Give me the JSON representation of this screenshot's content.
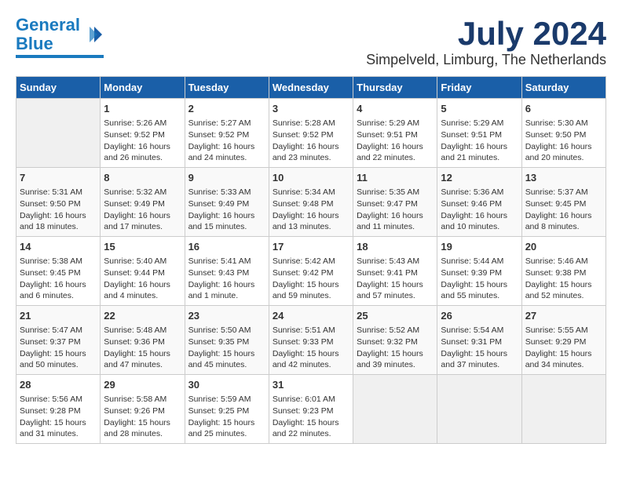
{
  "header": {
    "logo_line1": "General",
    "logo_line2": "Blue",
    "month": "July 2024",
    "location": "Simpelveld, Limburg, The Netherlands"
  },
  "days_of_week": [
    "Sunday",
    "Monday",
    "Tuesday",
    "Wednesday",
    "Thursday",
    "Friday",
    "Saturday"
  ],
  "weeks": [
    [
      {
        "day": "",
        "content": ""
      },
      {
        "day": "1",
        "content": "Sunrise: 5:26 AM\nSunset: 9:52 PM\nDaylight: 16 hours\nand 26 minutes."
      },
      {
        "day": "2",
        "content": "Sunrise: 5:27 AM\nSunset: 9:52 PM\nDaylight: 16 hours\nand 24 minutes."
      },
      {
        "day": "3",
        "content": "Sunrise: 5:28 AM\nSunset: 9:52 PM\nDaylight: 16 hours\nand 23 minutes."
      },
      {
        "day": "4",
        "content": "Sunrise: 5:29 AM\nSunset: 9:51 PM\nDaylight: 16 hours\nand 22 minutes."
      },
      {
        "day": "5",
        "content": "Sunrise: 5:29 AM\nSunset: 9:51 PM\nDaylight: 16 hours\nand 21 minutes."
      },
      {
        "day": "6",
        "content": "Sunrise: 5:30 AM\nSunset: 9:50 PM\nDaylight: 16 hours\nand 20 minutes."
      }
    ],
    [
      {
        "day": "7",
        "content": "Sunrise: 5:31 AM\nSunset: 9:50 PM\nDaylight: 16 hours\nand 18 minutes."
      },
      {
        "day": "8",
        "content": "Sunrise: 5:32 AM\nSunset: 9:49 PM\nDaylight: 16 hours\nand 17 minutes."
      },
      {
        "day": "9",
        "content": "Sunrise: 5:33 AM\nSunset: 9:49 PM\nDaylight: 16 hours\nand 15 minutes."
      },
      {
        "day": "10",
        "content": "Sunrise: 5:34 AM\nSunset: 9:48 PM\nDaylight: 16 hours\nand 13 minutes."
      },
      {
        "day": "11",
        "content": "Sunrise: 5:35 AM\nSunset: 9:47 PM\nDaylight: 16 hours\nand 11 minutes."
      },
      {
        "day": "12",
        "content": "Sunrise: 5:36 AM\nSunset: 9:46 PM\nDaylight: 16 hours\nand 10 minutes."
      },
      {
        "day": "13",
        "content": "Sunrise: 5:37 AM\nSunset: 9:45 PM\nDaylight: 16 hours\nand 8 minutes."
      }
    ],
    [
      {
        "day": "14",
        "content": "Sunrise: 5:38 AM\nSunset: 9:45 PM\nDaylight: 16 hours\nand 6 minutes."
      },
      {
        "day": "15",
        "content": "Sunrise: 5:40 AM\nSunset: 9:44 PM\nDaylight: 16 hours\nand 4 minutes."
      },
      {
        "day": "16",
        "content": "Sunrise: 5:41 AM\nSunset: 9:43 PM\nDaylight: 16 hours\nand 1 minute."
      },
      {
        "day": "17",
        "content": "Sunrise: 5:42 AM\nSunset: 9:42 PM\nDaylight: 15 hours\nand 59 minutes."
      },
      {
        "day": "18",
        "content": "Sunrise: 5:43 AM\nSunset: 9:41 PM\nDaylight: 15 hours\nand 57 minutes."
      },
      {
        "day": "19",
        "content": "Sunrise: 5:44 AM\nSunset: 9:39 PM\nDaylight: 15 hours\nand 55 minutes."
      },
      {
        "day": "20",
        "content": "Sunrise: 5:46 AM\nSunset: 9:38 PM\nDaylight: 15 hours\nand 52 minutes."
      }
    ],
    [
      {
        "day": "21",
        "content": "Sunrise: 5:47 AM\nSunset: 9:37 PM\nDaylight: 15 hours\nand 50 minutes."
      },
      {
        "day": "22",
        "content": "Sunrise: 5:48 AM\nSunset: 9:36 PM\nDaylight: 15 hours\nand 47 minutes."
      },
      {
        "day": "23",
        "content": "Sunrise: 5:50 AM\nSunset: 9:35 PM\nDaylight: 15 hours\nand 45 minutes."
      },
      {
        "day": "24",
        "content": "Sunrise: 5:51 AM\nSunset: 9:33 PM\nDaylight: 15 hours\nand 42 minutes."
      },
      {
        "day": "25",
        "content": "Sunrise: 5:52 AM\nSunset: 9:32 PM\nDaylight: 15 hours\nand 39 minutes."
      },
      {
        "day": "26",
        "content": "Sunrise: 5:54 AM\nSunset: 9:31 PM\nDaylight: 15 hours\nand 37 minutes."
      },
      {
        "day": "27",
        "content": "Sunrise: 5:55 AM\nSunset: 9:29 PM\nDaylight: 15 hours\nand 34 minutes."
      }
    ],
    [
      {
        "day": "28",
        "content": "Sunrise: 5:56 AM\nSunset: 9:28 PM\nDaylight: 15 hours\nand 31 minutes."
      },
      {
        "day": "29",
        "content": "Sunrise: 5:58 AM\nSunset: 9:26 PM\nDaylight: 15 hours\nand 28 minutes."
      },
      {
        "day": "30",
        "content": "Sunrise: 5:59 AM\nSunset: 9:25 PM\nDaylight: 15 hours\nand 25 minutes."
      },
      {
        "day": "31",
        "content": "Sunrise: 6:01 AM\nSunset: 9:23 PM\nDaylight: 15 hours\nand 22 minutes."
      },
      {
        "day": "",
        "content": ""
      },
      {
        "day": "",
        "content": ""
      },
      {
        "day": "",
        "content": ""
      }
    ]
  ]
}
